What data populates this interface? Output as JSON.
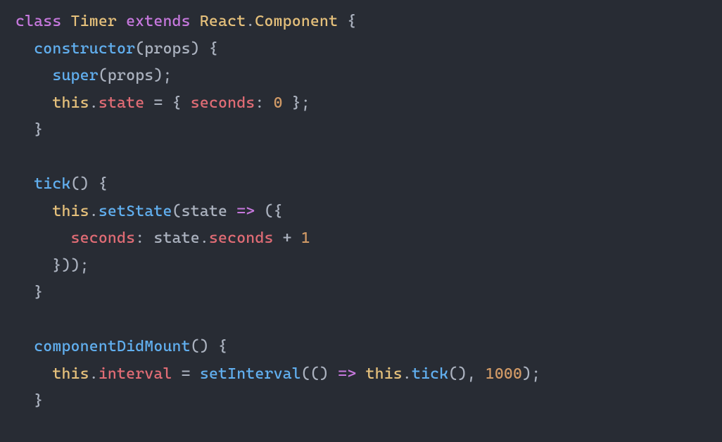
{
  "tokens": {
    "kw_class": "class",
    "class_name": "Timer",
    "kw_extends": "extends",
    "react": "React",
    "dot": ".",
    "component": "Component",
    "lbrace": "{",
    "rbrace": "}",
    "constructor": "constructor",
    "lparen": "(",
    "rparen": ")",
    "props": "props",
    "super": "super",
    "semicolon": ";",
    "this": "this",
    "state": "state",
    "equals": "=",
    "seconds": "seconds",
    "colon": ":",
    "zero": "0",
    "tick": "tick",
    "setState": "setState",
    "arrow": "=>",
    "plus": "+",
    "one": "1",
    "componentDidMount": "componentDidMount",
    "interval": "interval",
    "setInterval": "setInterval",
    "thousand": "1000",
    "comma": ","
  }
}
